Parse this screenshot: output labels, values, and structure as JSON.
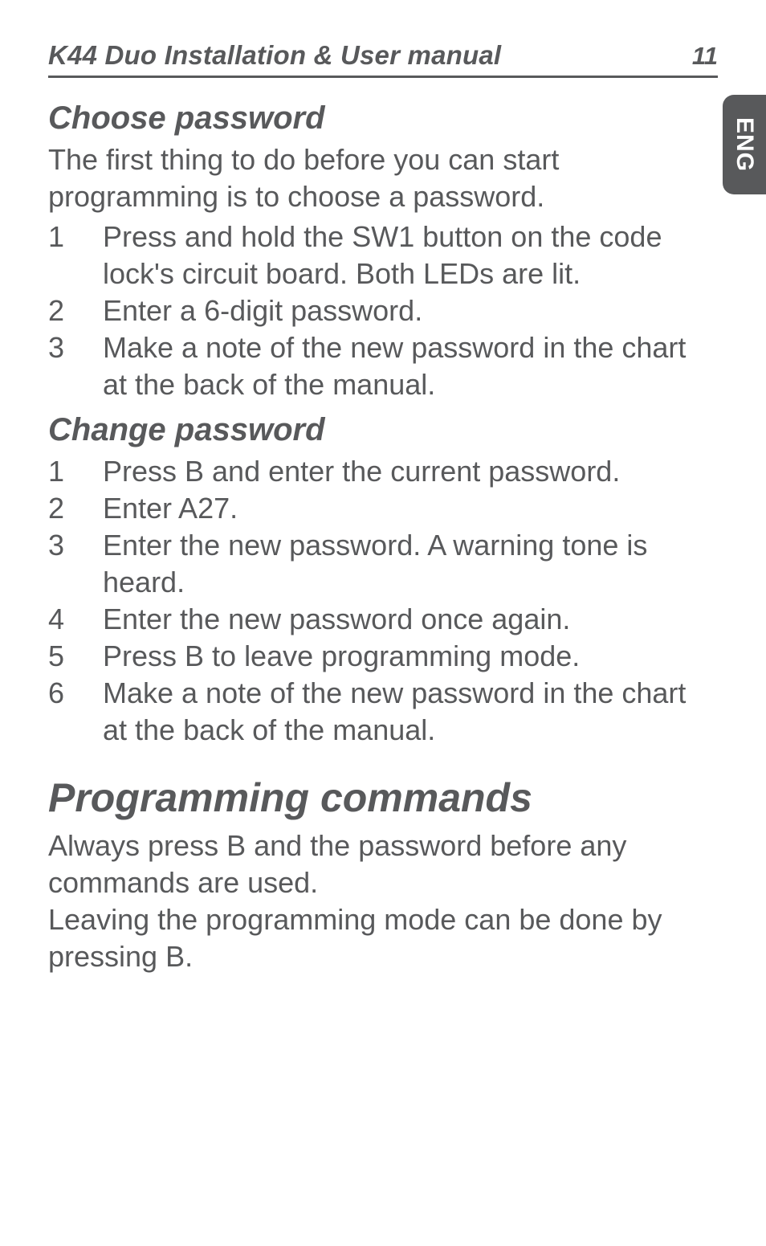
{
  "header": {
    "title": "K44 Duo Installation & User manual",
    "page_number": "11"
  },
  "side_tab": "ENG",
  "section_choose": {
    "heading": "Choose password",
    "intro": "The first thing to do before you can start programming is to choose a password.",
    "items": [
      {
        "n": "1",
        "t": "Press and hold the SW1 button on the code lock's circuit board. Both LEDs are lit."
      },
      {
        "n": "2",
        "t": "Enter a 6-digit password."
      },
      {
        "n": "3",
        "t": "Make a note of the new password in the chart at the back of the manual."
      }
    ]
  },
  "section_change": {
    "heading": "Change password",
    "items": [
      {
        "n": "1",
        "t": "Press B and enter the current password."
      },
      {
        "n": "2",
        "t": "Enter A27."
      },
      {
        "n": "3",
        "t": "Enter the new password. A warning tone is heard."
      },
      {
        "n": "4",
        "t": "Enter the new password once again."
      },
      {
        "n": "5",
        "t": "Press B to leave programming mode."
      },
      {
        "n": "6",
        "t": "Make a note of the new password in the chart at the back of the manual."
      }
    ]
  },
  "section_prog": {
    "heading": "Programming commands",
    "para1": "Always press B and the password before any commands are used.",
    "para2": "Leaving the programming mode can be done by pressing B."
  }
}
